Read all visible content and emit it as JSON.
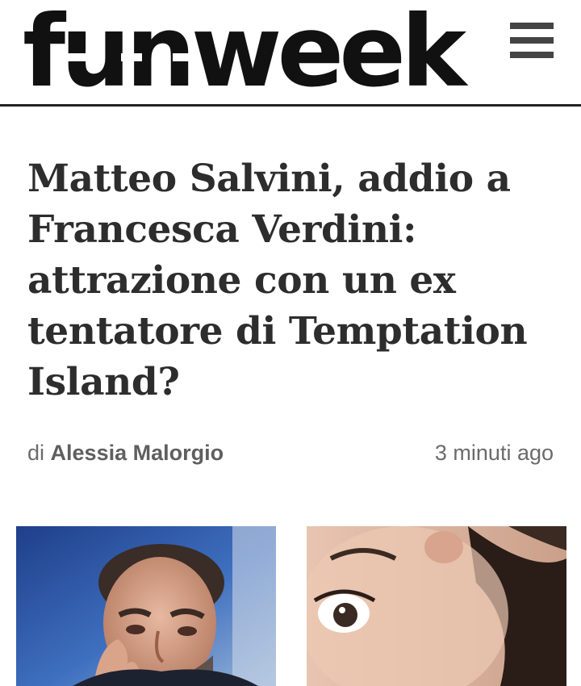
{
  "header": {
    "logo_text": "funweek",
    "menu_icon": "hamburger-icon"
  },
  "article": {
    "title_lines": [
      "Matteo Salvini, addio a",
      "Francesca Verdini:",
      "attrazione con un ex",
      "tentatore di Temptation",
      "Island?"
    ],
    "byline_prefix": "di",
    "author": "Alessia Malorgio",
    "time_ago": "3 minuti ago"
  },
  "images": [
    {
      "subject": "man-portrait-photo"
    },
    {
      "subject": "woman-portrait-photo"
    }
  ],
  "colors": {
    "text_dark": "#2d2d2d",
    "text_muted": "#6b6b6b",
    "header_border": "#222222",
    "menu_icon": "#444444"
  }
}
